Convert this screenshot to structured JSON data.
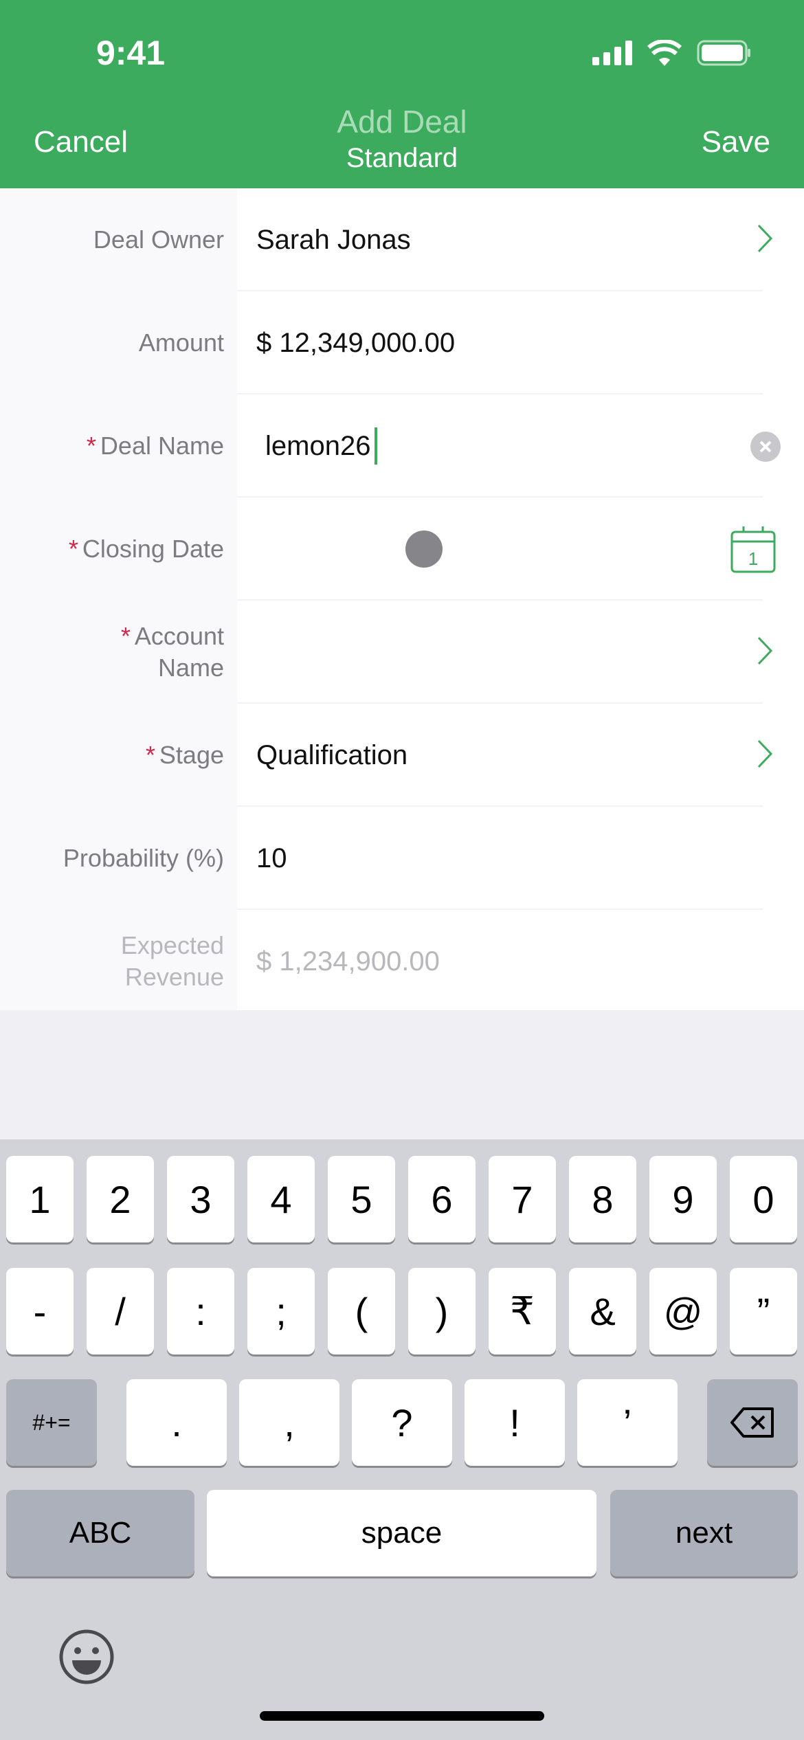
{
  "status": {
    "time": "9:41"
  },
  "nav": {
    "cancel": "Cancel",
    "title": "Add Deal",
    "subtitle": "Standard",
    "save": "Save"
  },
  "colors": {
    "brand": "#3dab5e",
    "required": "#d0284a"
  },
  "fields": [
    {
      "label": "Deal Owner",
      "value": "Sarah Jonas",
      "required": false,
      "accessory": "chevron-right-icon"
    },
    {
      "label": "Amount",
      "value": "$ 12,349,000.00",
      "required": false
    },
    {
      "label": "Deal Name",
      "value": "lemon26",
      "required": true,
      "accessory": "clear-icon"
    },
    {
      "label": "Closing Date",
      "value": "",
      "required": true,
      "accessory": "calendar-icon",
      "calendar_day": "1"
    },
    {
      "label": "Account Name",
      "value": "",
      "required": true,
      "accessory": "chevron-right-icon"
    },
    {
      "label": "Stage",
      "value": "Qualification",
      "required": true,
      "accessory": "chevron-right-icon"
    },
    {
      "label": "Probability (%)",
      "value": "10",
      "required": false
    },
    {
      "label": "Expected Revenue",
      "value": "$ 1,234,900.00",
      "required": false
    }
  ],
  "keyboard": {
    "row1": [
      "1",
      "2",
      "3",
      "4",
      "5",
      "6",
      "7",
      "8",
      "9",
      "0"
    ],
    "row2": [
      "-",
      "/",
      ":",
      ";",
      "(",
      ")",
      "₹",
      "&",
      "@",
      "”"
    ],
    "row3": [
      "#+=",
      ".",
      ",",
      "?",
      "!",
      "’"
    ],
    "abc": "ABC",
    "space": "space",
    "next": "next"
  }
}
